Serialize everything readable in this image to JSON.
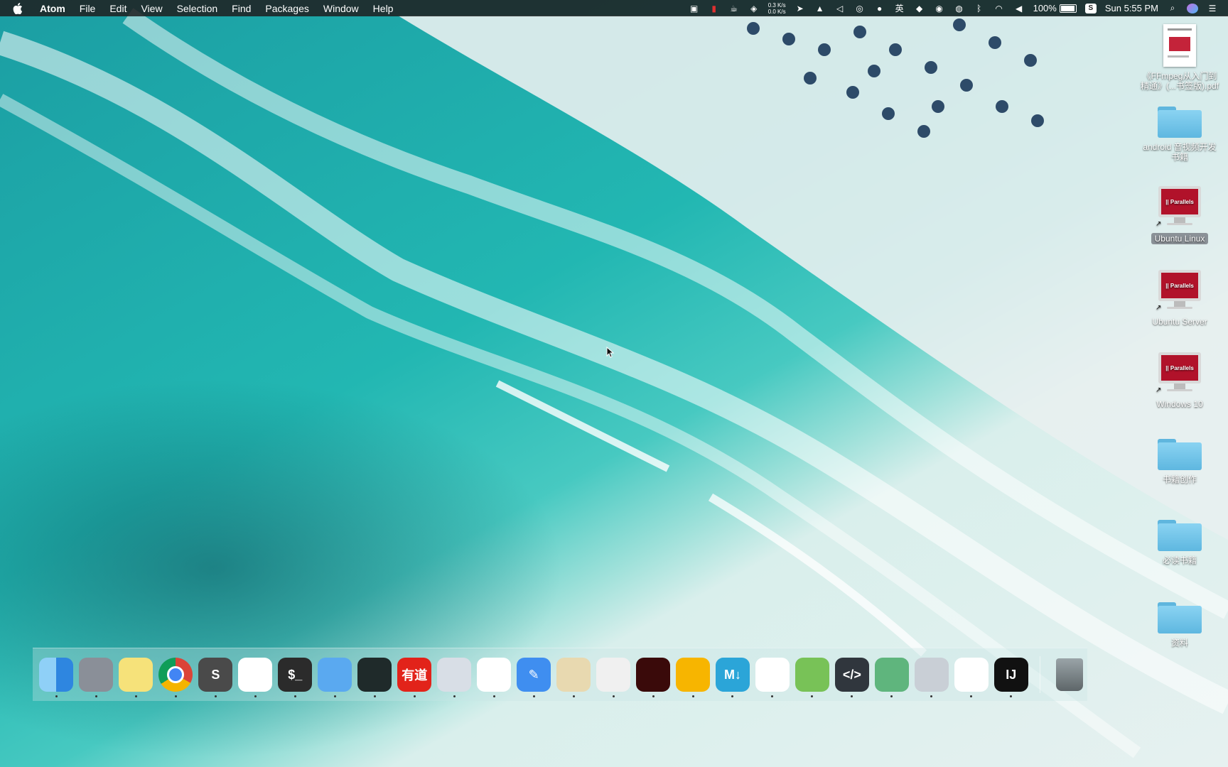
{
  "menubar": {
    "app_name": "Atom",
    "menus": [
      "File",
      "Edit",
      "View",
      "Selection",
      "Find",
      "Packages",
      "Window",
      "Help"
    ],
    "netspeed_up": "0.3 K/s",
    "netspeed_down": "0.0 K/s",
    "input_method": "英",
    "battery_percent": "100%",
    "clock": "Sun 5:55 PM"
  },
  "desktop": {
    "items": [
      {
        "label": "《FFmpeg从入门到精通》(...书签版).pdf",
        "kind": "pdf"
      },
      {
        "label": "android 音视频开发书籍",
        "kind": "folder"
      },
      {
        "label": "Ubuntu Linux",
        "kind": "parallels-vm"
      },
      {
        "label": "Ubuntu Server",
        "kind": "parallels-vm"
      },
      {
        "label": "Windows 10",
        "kind": "parallels-vm"
      },
      {
        "label": "书籍创作",
        "kind": "folder"
      },
      {
        "label": "必读书籍",
        "kind": "folder"
      },
      {
        "label": "资料",
        "kind": "folder"
      }
    ],
    "parallels_logo_text": "|| Parallels"
  },
  "dock": {
    "apps": [
      {
        "name": "finder-icon",
        "glyph": "",
        "color": "#3b9cf0"
      },
      {
        "name": "launchpad-icon",
        "glyph": "",
        "color": "#8a8f98"
      },
      {
        "name": "notes-icon",
        "glyph": "",
        "color": "#f6e27a"
      },
      {
        "name": "chrome-icon",
        "glyph": "",
        "color": "#ffffff"
      },
      {
        "name": "sublime-text-icon",
        "glyph": "S",
        "color": "#4a4a4a"
      },
      {
        "name": "wechat-icon",
        "glyph": "",
        "color": "#ffffff"
      },
      {
        "name": "terminal-icon",
        "glyph": "$_",
        "color": "#2b2b2b"
      },
      {
        "name": "xcode-icon",
        "glyph": "",
        "color": "#5aa9f0"
      },
      {
        "name": "activity-monitor-icon",
        "glyph": "",
        "color": "#1f2a2a"
      },
      {
        "name": "youdao-icon",
        "glyph": "有道",
        "color": "#e2231a"
      },
      {
        "name": "parallels-icon",
        "glyph": "",
        "color": "#d8dee6"
      },
      {
        "name": "qq-icon",
        "glyph": "",
        "color": "#ffffff"
      },
      {
        "name": "pencil-app-icon",
        "glyph": "✎",
        "color": "#3f8ef0"
      },
      {
        "name": "cocktail-icon",
        "glyph": "",
        "color": "#e8d9b0"
      },
      {
        "name": "pitcher-icon",
        "glyph": "",
        "color": "#f0f0f0"
      },
      {
        "name": "acrobat-icon",
        "glyph": "",
        "color": "#3a0a0a"
      },
      {
        "name": "sketch-icon",
        "glyph": "",
        "color": "#f7b500"
      },
      {
        "name": "markdown-icon",
        "glyph": "M↓",
        "color": "#2ba5d8"
      },
      {
        "name": "unity-icon",
        "glyph": "",
        "color": "#ffffff"
      },
      {
        "name": "android-studio-icon",
        "glyph": "",
        "color": "#78c257"
      },
      {
        "name": "code-editor-icon",
        "glyph": "</>",
        "color": "#30363d"
      },
      {
        "name": "atom-icon",
        "glyph": "",
        "color": "#5fb57d"
      },
      {
        "name": "photo-slideshow-icon",
        "glyph": "",
        "color": "#c9cfd6"
      },
      {
        "name": "baidu-netdisk-icon",
        "glyph": "",
        "color": "#ffffff"
      },
      {
        "name": "intellij-idea-icon",
        "glyph": "IJ",
        "color": "#111111"
      }
    ],
    "trash": {
      "name": "trash-icon"
    }
  }
}
